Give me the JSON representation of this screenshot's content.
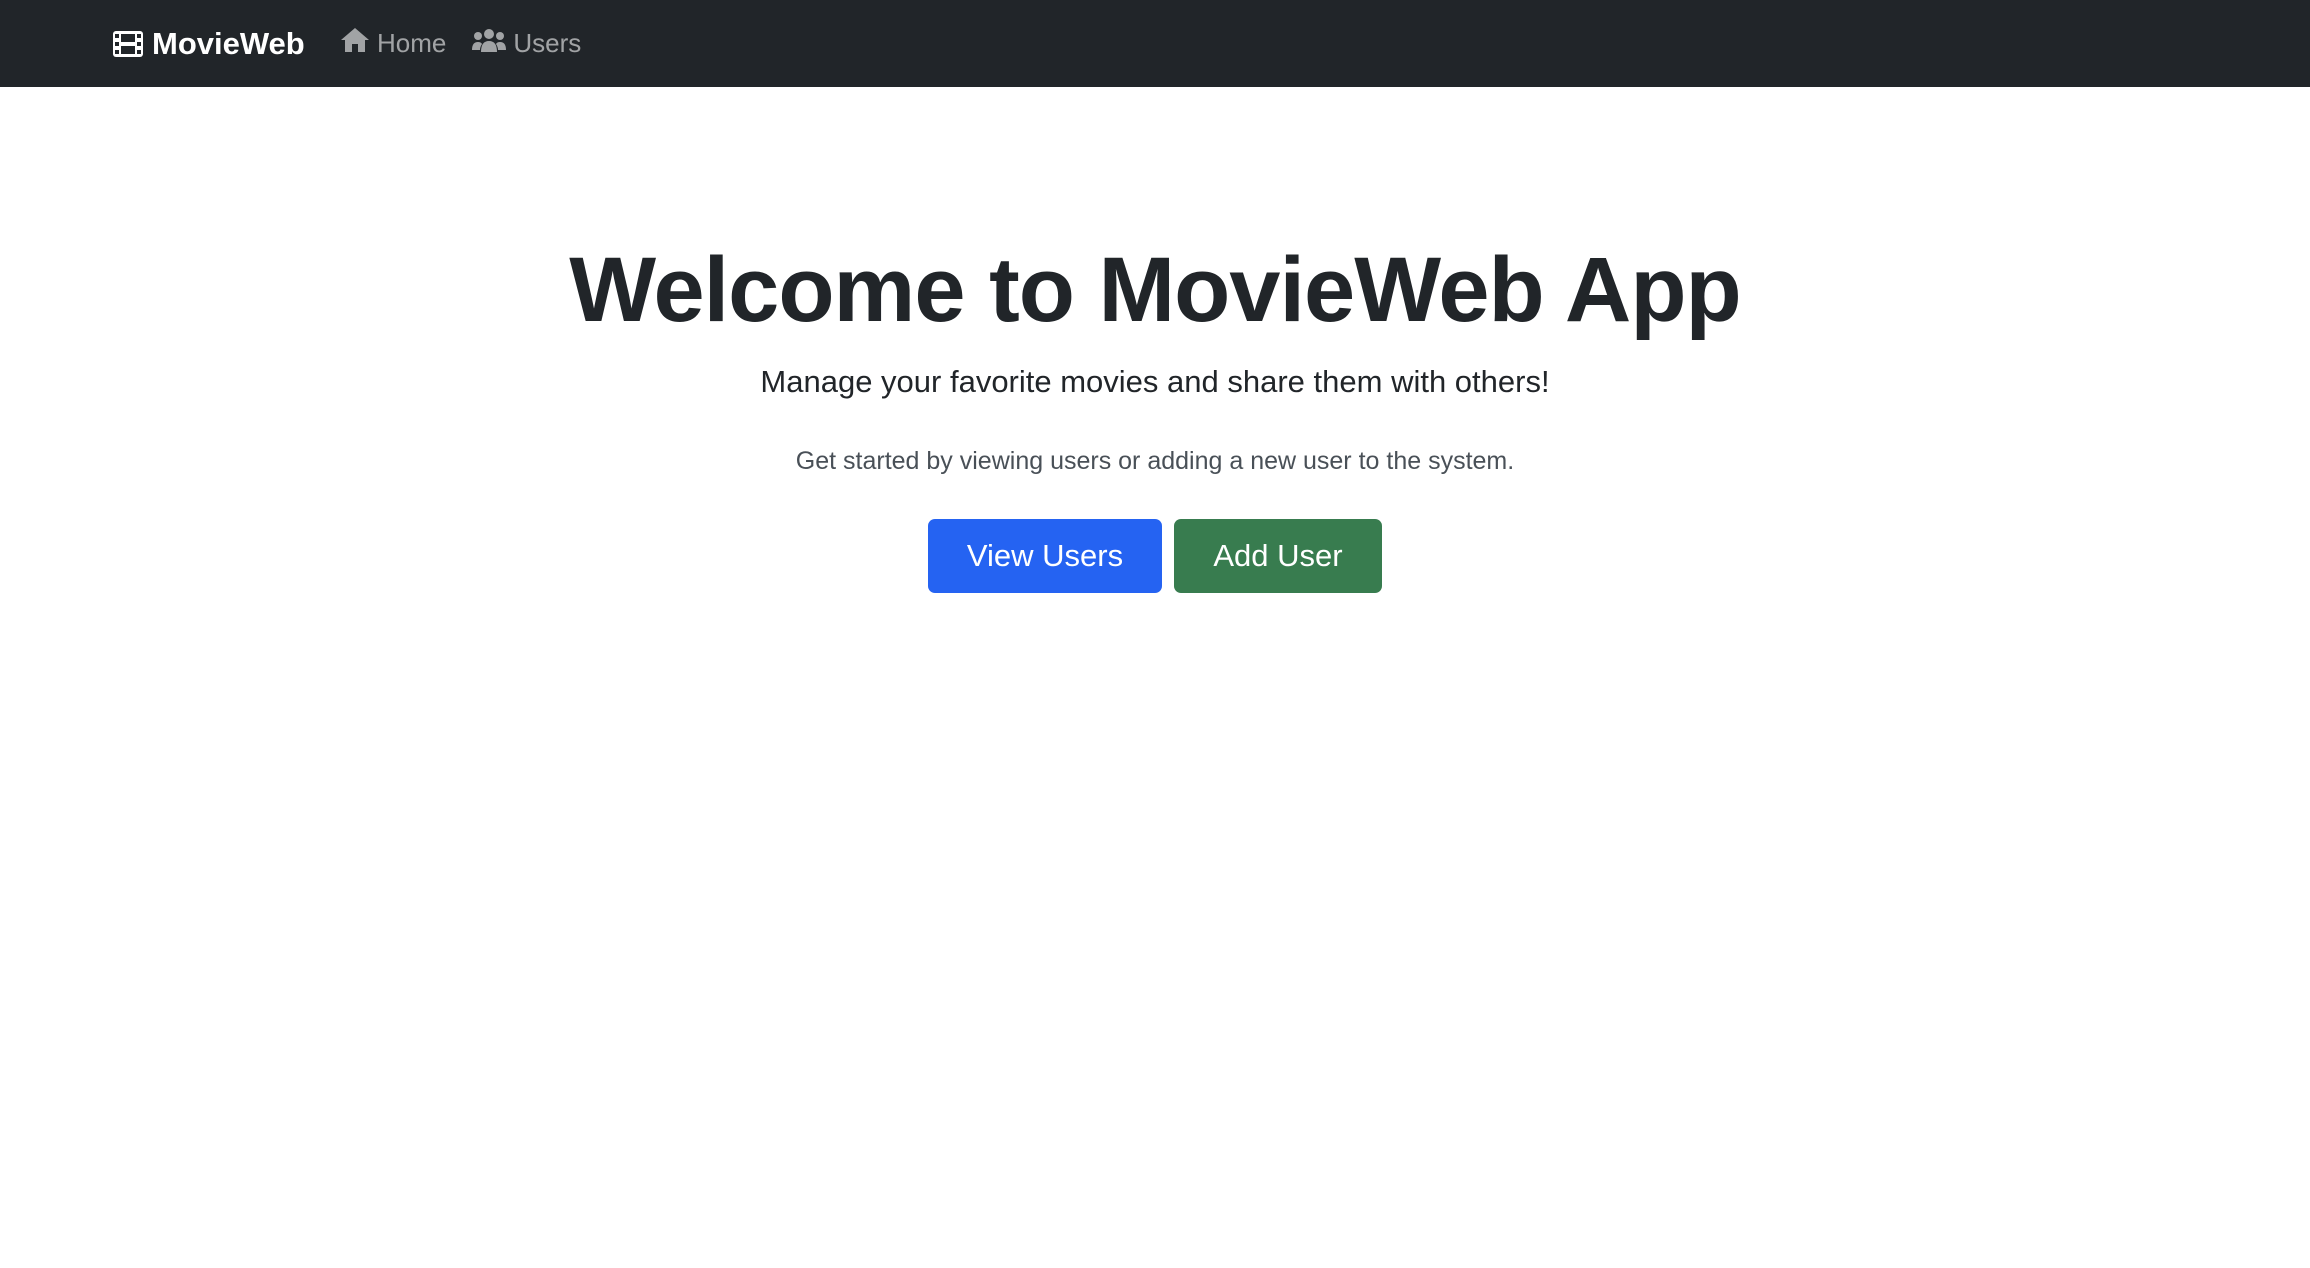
{
  "navbar": {
    "brand": "MovieWeb",
    "brand_icon": "film-icon",
    "links": [
      {
        "label": "Home",
        "icon": "home-icon"
      },
      {
        "label": "Users",
        "icon": "users-icon"
      }
    ],
    "background": "#212529"
  },
  "hero": {
    "title": "Welcome to MovieWeb App",
    "lead": "Manage your favorite movies and share them with others!",
    "subtext": "Get started by viewing users or adding a new user to the system.",
    "buttons": {
      "view_users": "View Users",
      "add_user": "Add User"
    }
  },
  "colors": {
    "primary": "#2563f2",
    "success": "#387c4f"
  }
}
